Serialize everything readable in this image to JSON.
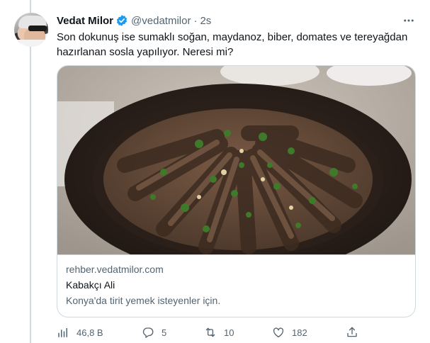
{
  "tweet": {
    "author_name": "Vedat Milor",
    "handle": "@vedatmilor",
    "separator": "·",
    "time": "2s",
    "text": "Son dokunuş ise sumaklı soğan, maydanoz, biber, domates ve tereyağdan hazırlanan sosla yapılıyor. Neresi mi?"
  },
  "card": {
    "domain": "rehber.vedatmilor.com",
    "title": "Kabakçı Ali",
    "description": "Konya'da tirit yemek isteyenler için."
  },
  "actions": {
    "views": "46,8 B",
    "replies": "5",
    "retweets": "10",
    "likes": "182"
  },
  "colors": {
    "verified": "#1d9bf0",
    "muted_text": "#536471",
    "border": "#cfd9de"
  },
  "icons": [
    "more-icon",
    "verified-badge-icon",
    "views-icon",
    "reply-icon",
    "retweet-icon",
    "like-icon",
    "share-icon"
  ]
}
